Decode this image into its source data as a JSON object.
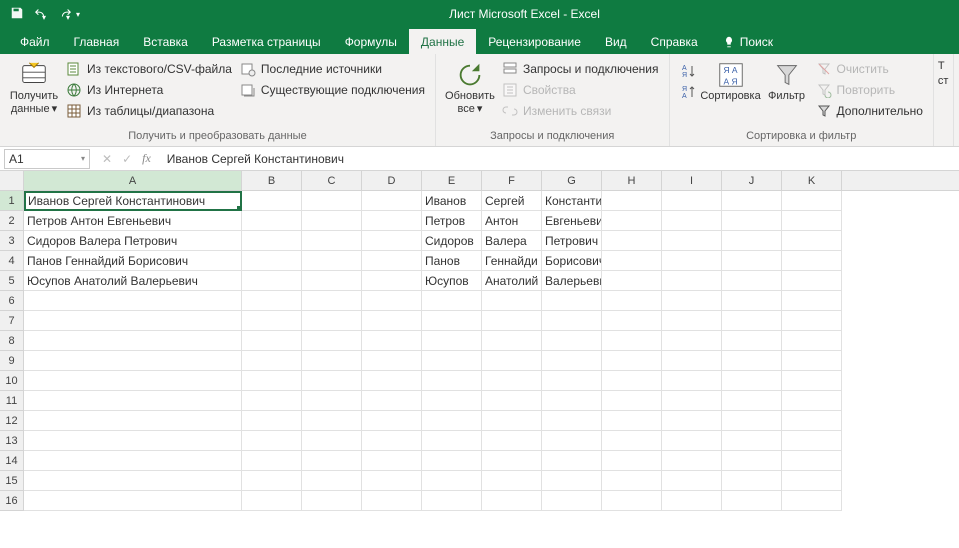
{
  "title": "Лист Microsoft Excel  -  Excel",
  "tabs": [
    "Файл",
    "Главная",
    "Вставка",
    "Разметка страницы",
    "Формулы",
    "Данные",
    "Рецензирование",
    "Вид",
    "Справка"
  ],
  "activeTab": 5,
  "search": "Поиск",
  "ribbon": {
    "g1": {
      "label": "Получить и преобразовать данные",
      "big": {
        "l1": "Получить",
        "l2": "данные"
      },
      "items": [
        "Из текстового/CSV-файла",
        "Из Интернета",
        "Из таблицы/диапазона",
        "Последние источники",
        "Существующие подключения"
      ]
    },
    "g2": {
      "label": "Запросы и подключения",
      "big": {
        "l1": "Обновить",
        "l2": "все"
      },
      "items": [
        "Запросы и подключения",
        "Свойства",
        "Изменить связи"
      ]
    },
    "g3": {
      "label": "Сортировка и фильтр",
      "b1": "Сортировка",
      "b2": "Фильтр",
      "items": [
        "Очистить",
        "Повторить",
        "Дополнительно"
      ]
    },
    "g4": {
      "l1": "Т",
      "l2": "ст"
    }
  },
  "namebox": "A1",
  "formula": "Иванов Сергей Константинович",
  "cols": [
    "A",
    "B",
    "C",
    "D",
    "E",
    "F",
    "G",
    "H",
    "I",
    "J",
    "K"
  ],
  "rows": 16,
  "data": {
    "1": {
      "A": "Иванов Сергей Константинович",
      "E": "Иванов",
      "F": "Сергей",
      "G": "Константинович"
    },
    "2": {
      "A": "Петров Антон Евгеньевич",
      "E": "Петров",
      "F": "Антон",
      "G": "Евгеньевич"
    },
    "3": {
      "A": "Сидоров Валера Петрович",
      "E": "Сидоров",
      "F": "Валера",
      "G": "Петрович"
    },
    "4": {
      "A": "Панов Геннайдий Борисович",
      "E": "Панов",
      "F": "Геннайди",
      "G": "Борисович"
    },
    "5": {
      "A": "Юсупов Анатолий Валерьевич",
      "E": "Юсупов",
      "F": "Анатолий",
      "G": "Валерьевич"
    }
  },
  "activeCell": {
    "r": 1,
    "c": "A"
  }
}
